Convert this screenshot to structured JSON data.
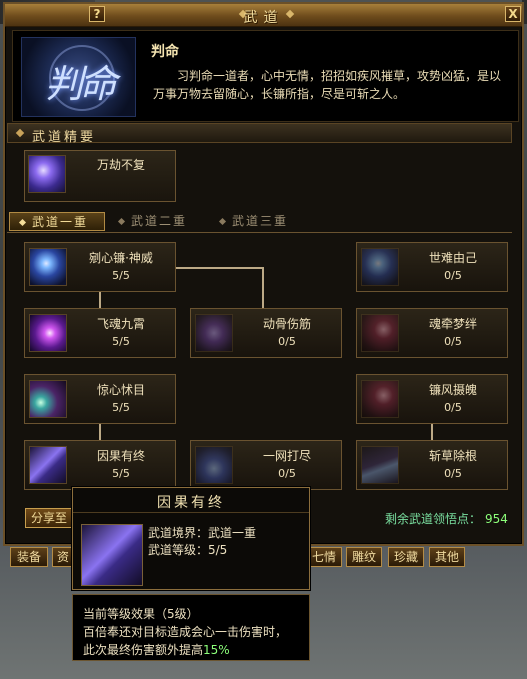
{
  "window": {
    "title": "武道",
    "help_label": "?",
    "close_label": "X"
  },
  "style": {
    "emblem_text": "判命",
    "name": "判命",
    "description": "习判命一道者，心中无情，招招如疾风摧草，攻势凶猛，是以万事万物去留随心，长镰所指，尽是可斩之人。"
  },
  "summary": {
    "section_title": "武道精要",
    "skill": {
      "name": "万劫不复",
      "icon": "swirl-vortex-icon"
    }
  },
  "tabs": [
    {
      "label": "武道一重",
      "active": true
    },
    {
      "label": "武道二重",
      "active": false
    },
    {
      "label": "武道三重",
      "active": false
    }
  ],
  "skills": [
    {
      "name": "剜心镰·神威",
      "level": "5/5",
      "icon": "scythe-strike-icon"
    },
    {
      "name": "飞魂九霄",
      "level": "5/5",
      "icon": "soul-flight-icon"
    },
    {
      "name": "动骨伤筋",
      "level": "0/5",
      "icon": "bone-break-icon"
    },
    {
      "name": "惊心怵目",
      "level": "5/5",
      "icon": "shock-eye-icon"
    },
    {
      "name": "因果有终",
      "level": "5/5",
      "icon": "karma-end-icon"
    },
    {
      "name": "一网打尽",
      "level": "0/5",
      "icon": "net-sweep-icon"
    },
    {
      "name": "世难由己",
      "level": "0/5",
      "icon": "fate-icon"
    },
    {
      "name": "魂牵梦绊",
      "level": "0/5",
      "icon": "soul-bind-icon"
    },
    {
      "name": "镰风摄魄",
      "level": "0/5",
      "icon": "scythe-wind-icon"
    },
    {
      "name": "斩草除根",
      "level": "0/5",
      "icon": "uproot-icon"
    }
  ],
  "share_label": "分享至",
  "points": {
    "label": "剩余武道领悟点：",
    "value": "954"
  },
  "bottom_menu": [
    "装备",
    "资",
    "七情",
    "雕纹",
    "珍藏",
    "其他"
  ],
  "tooltip": {
    "title": "因果有终",
    "realm_line": "武道境界：武道一重",
    "level_line": "武道等级：5/5",
    "effect_header": "当前等级效果（5级）",
    "effect_line1": "百倍奉还对目标造成会心一击伤害时，",
    "effect_line2_prefix": "此次最终伤害额外提高",
    "effect_value": "15%"
  }
}
